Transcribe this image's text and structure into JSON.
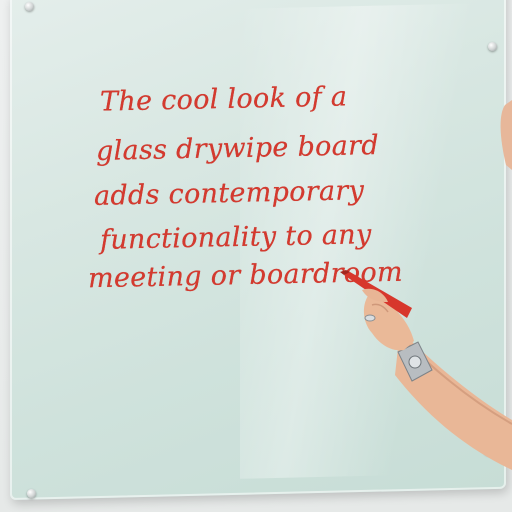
{
  "photo": {
    "subject": "glass-drywipe-board",
    "ink_color": "#d43a2f",
    "handwriting_lines": [
      "The cool look of a",
      "glass drywipe board",
      "adds contemporary",
      "functionality to any",
      "meeting or boardroom"
    ]
  }
}
